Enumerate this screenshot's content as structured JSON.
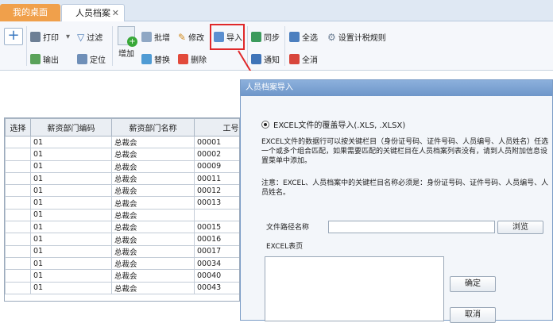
{
  "tabs": {
    "home": "我的桌面",
    "staff": "人员档案",
    "close": "✕"
  },
  "toolbar": {
    "add": "+",
    "print": "打印",
    "print_arrow": "▾",
    "filter": "过滤",
    "export": "输出",
    "locate": "定位",
    "new": "增加",
    "batch_add": "批增",
    "edit": "修改",
    "import": "导入",
    "sync": "同步",
    "select_all": "全选",
    "tax_rules": "设置计税规则",
    "replace": "替换",
    "delete": "删除",
    "notify": "通知",
    "deselect_all": "全消"
  },
  "table": {
    "columns": [
      "选择",
      "薪资部门编码",
      "薪资部门名称",
      "工号"
    ],
    "rows": [
      [
        "",
        "01",
        "总裁会",
        "00001"
      ],
      [
        "",
        "01",
        "总裁会",
        "00002"
      ],
      [
        "",
        "01",
        "总裁会",
        "00009"
      ],
      [
        "",
        "01",
        "总裁会",
        "00011"
      ],
      [
        "",
        "01",
        "总裁会",
        "00012"
      ],
      [
        "",
        "01",
        "总裁会",
        "00013"
      ],
      [
        "",
        "01",
        "总裁会",
        ""
      ],
      [
        "",
        "01",
        "总裁会",
        "00015"
      ],
      [
        "",
        "01",
        "总裁会",
        "00016"
      ],
      [
        "",
        "01",
        "总裁会",
        "00017"
      ],
      [
        "",
        "01",
        "总裁会",
        "00034"
      ],
      [
        "",
        "01",
        "总裁会",
        "00040"
      ],
      [
        "",
        "01",
        "总裁会",
        "00043"
      ]
    ]
  },
  "dialog": {
    "title": "人员档案导入",
    "radio_label": "EXCEL文件的覆盖导入(.XLS, .XLSX)",
    "description": "EXCEL文件的数据行可以按关键栏目（身份证号码、证件号码、人员编号、人员姓名）任选一个或多个组合匹配，如果需要匹配的关键栏目在人员档案列表没有，请到人员附加信息设置菜单中添加。",
    "note": "注意：EXCEL、人员档案中的关键栏目名称必须是：身份证号码、证件号码、人员编号、人员姓名。",
    "path_label": "文件路径名称",
    "path_value": "",
    "browse": "浏览",
    "sheet_label": "EXCEL表页",
    "ok": "确定",
    "cancel": "取消"
  },
  "colors": {
    "accent_tab": "#f0a04b",
    "highlight": "#e0282a",
    "dialog_title": "#7aa0cf"
  }
}
